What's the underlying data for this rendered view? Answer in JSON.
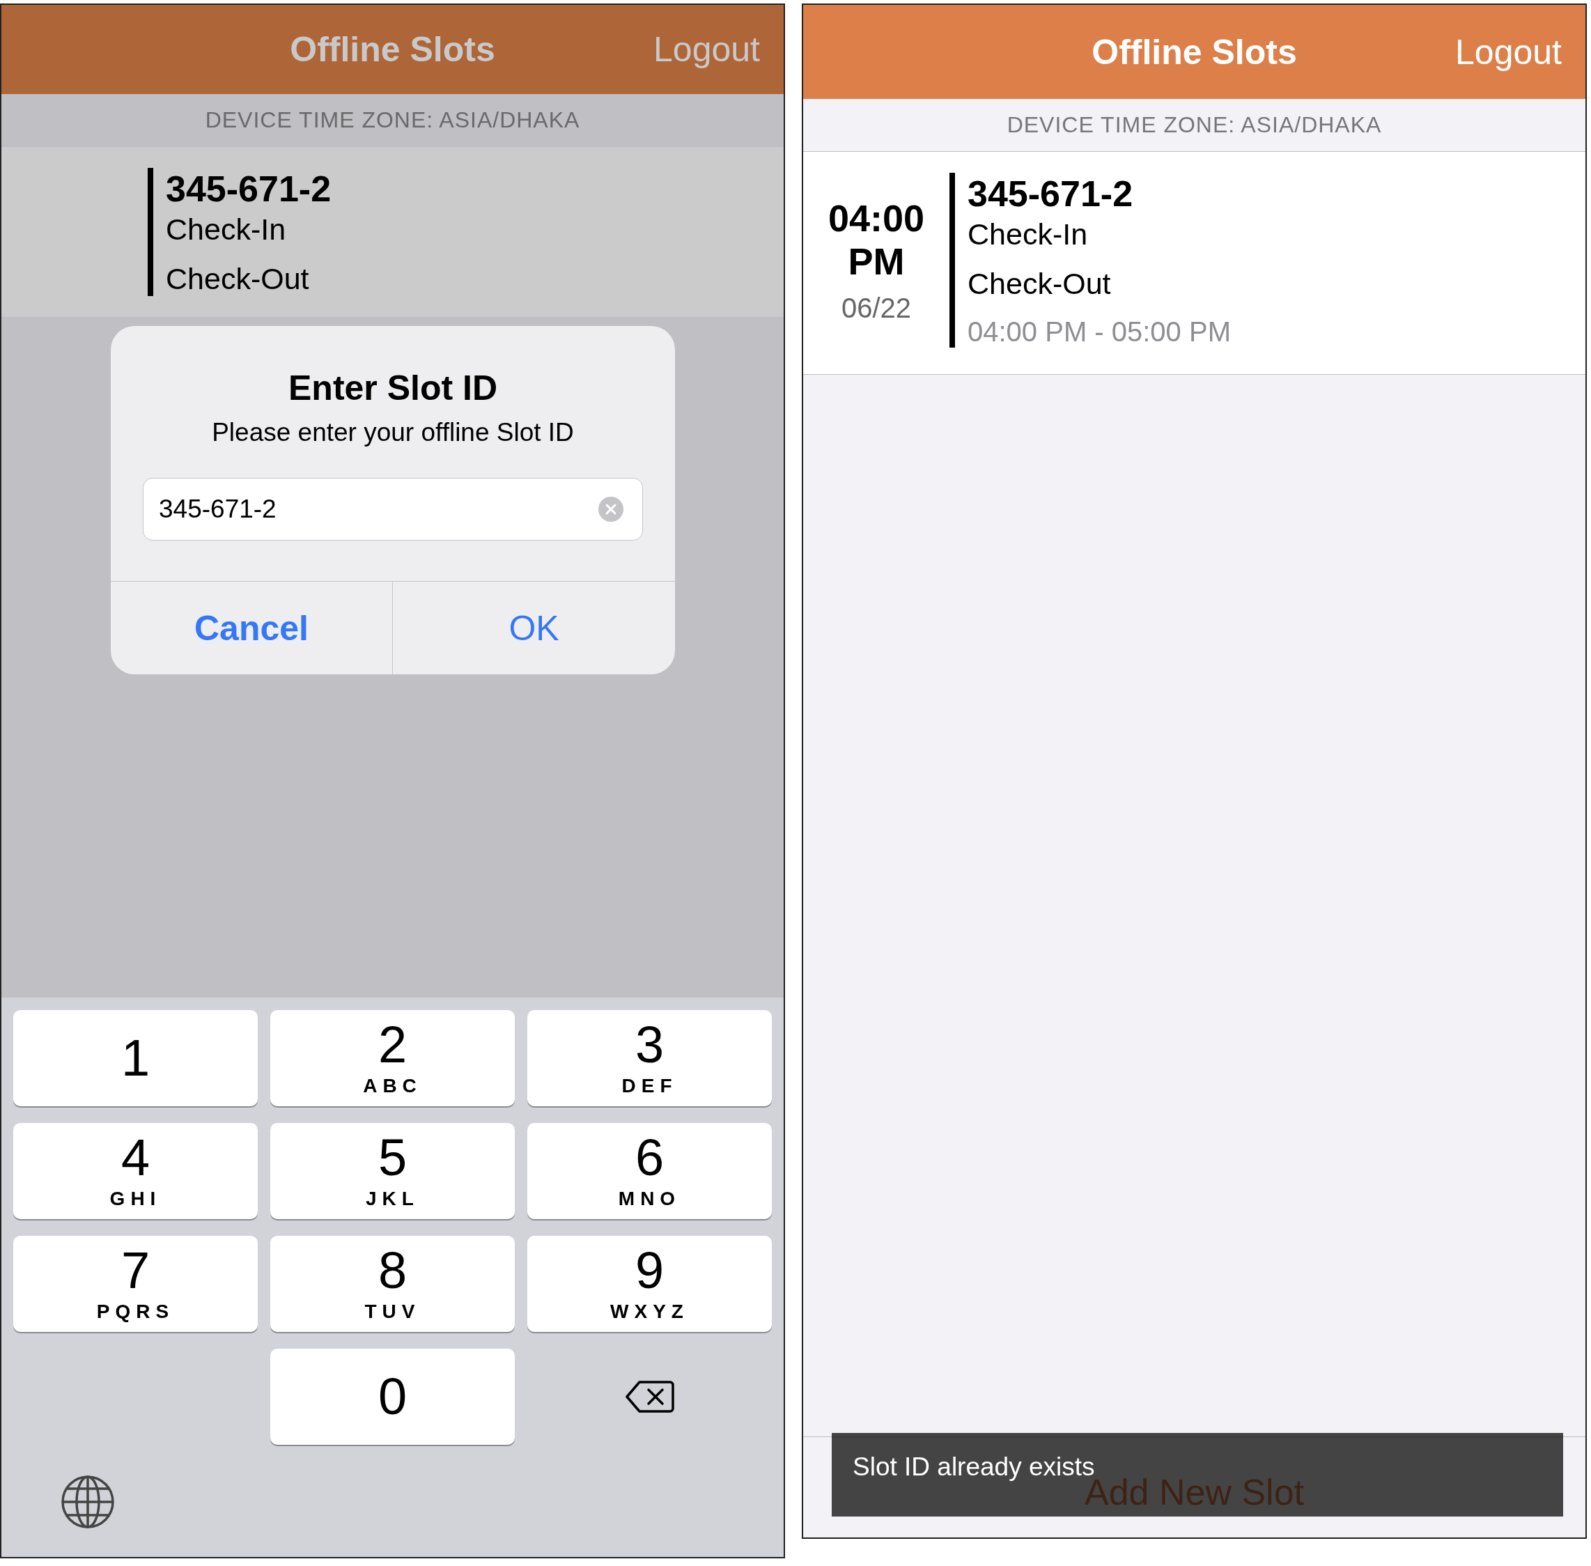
{
  "screens": [
    {
      "dimmed": true,
      "header": {
        "title": "Offline Slots",
        "action": "Logout"
      },
      "time_zone": "DEVICE TIME ZONE: ASIA/DHAKA",
      "slots": [
        {
          "id": "345-671-2",
          "check_in": "Check-In",
          "check_out": "Check-Out"
        }
      ],
      "dialog": {
        "title": "Enter Slot ID",
        "message": "Please enter your offline Slot ID",
        "value": "345-671-2",
        "buttons": [
          {
            "label": "Cancel",
            "preferred": true
          },
          {
            "label": "OK",
            "preferred": false
          }
        ]
      },
      "keyboard": {
        "keys": [
          {
            "kind": "digit",
            "digit": "1"
          },
          {
            "kind": "digit",
            "digit": "2",
            "letters": "ABC"
          },
          {
            "kind": "digit",
            "digit": "3",
            "letters": "DEF"
          },
          {
            "kind": "digit",
            "digit": "4",
            "letters": "GHI"
          },
          {
            "kind": "digit",
            "digit": "5",
            "letters": "JKL"
          },
          {
            "kind": "digit",
            "digit": "6",
            "letters": "MNO"
          },
          {
            "kind": "digit",
            "digit": "7",
            "letters": "PQRS"
          },
          {
            "kind": "digit",
            "digit": "8",
            "letters": "TUV"
          },
          {
            "kind": "digit",
            "digit": "9",
            "letters": "WXYZ"
          },
          {
            "kind": "blank"
          },
          {
            "kind": "digit",
            "digit": "0"
          },
          {
            "kind": "backspace"
          }
        ]
      }
    },
    {
      "dimmed": false,
      "header": {
        "title": "Offline Slots",
        "action": "Logout"
      },
      "time_zone": "DEVICE TIME ZONE: ASIA/DHAKA",
      "slots": [
        {
          "time": "04:00 PM",
          "date": "06/22",
          "id": "345-671-2",
          "check_in": "Check-In",
          "check_out": "Check-Out",
          "range": "04:00 PM - 05:00 PM"
        }
      ],
      "add_button": "Add New Slot",
      "toast": "Slot ID already exists"
    }
  ]
}
